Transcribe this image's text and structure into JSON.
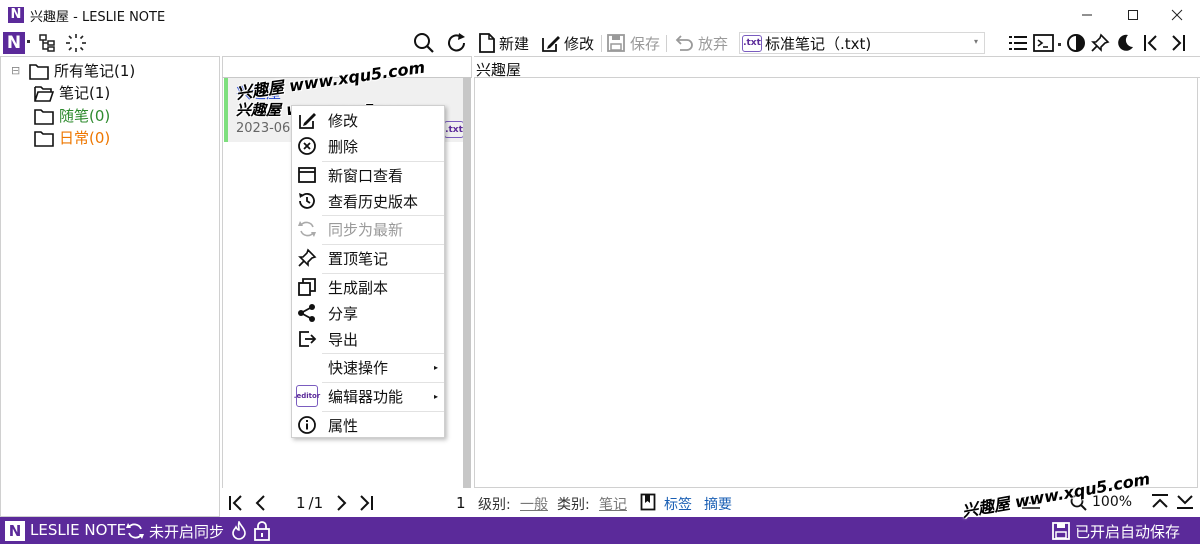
{
  "window": {
    "logo": "N",
    "title": "兴趣屋 - LESLIE NOTE"
  },
  "toolbar": {
    "new_label": "新建",
    "edit_label": "修改",
    "save_label": "保存",
    "discard_label": "放弃",
    "note_type_badge": ".txt",
    "note_type": "标准笔记（.txt)"
  },
  "tree": {
    "items": [
      {
        "label": "所有笔记(1)",
        "color": "#111111"
      },
      {
        "label": "笔记(1)",
        "color": "#111111"
      },
      {
        "label": "随笔(0)",
        "color": "#2e8b2e"
      },
      {
        "label": "日常(0)",
        "color": "#ee7700"
      }
    ]
  },
  "list": {
    "note": {
      "title": "兴趣屋",
      "summary": "兴趣屋 www.xqu5.com",
      "date": "2023-06-0",
      "badge": ".txt"
    },
    "pager": {
      "current": "1",
      "total": "/1",
      "count": "1"
    }
  },
  "editor": {
    "title": "兴趣屋",
    "level_label": "级别:",
    "level_value": "一般",
    "category_label": "类别:",
    "category_value": "笔记",
    "tags_label": "标签",
    "summary_label": "摘要",
    "zoom": "100%"
  },
  "context_menu": {
    "items": [
      {
        "label": "修改",
        "icon": "edit-icon"
      },
      {
        "label": "删除",
        "icon": "delete-icon"
      },
      {
        "label": "新窗口查看",
        "icon": "window-icon"
      },
      {
        "label": "查看历史版本",
        "icon": "history-icon"
      },
      {
        "label": "同步为最新",
        "icon": "sync-icon"
      },
      {
        "label": "置顶笔记",
        "icon": "pin-icon"
      },
      {
        "label": "生成副本",
        "icon": "copy-icon"
      },
      {
        "label": "分享",
        "icon": "share-icon"
      },
      {
        "label": "导出",
        "icon": "export-icon"
      },
      {
        "label": "快速操作",
        "icon": ""
      },
      {
        "label": "编辑器功能",
        "icon": "editor-icon"
      },
      {
        "label": "属性",
        "icon": "info-icon"
      }
    ],
    "editor_badge": ".editor"
  },
  "status": {
    "app_name": "LESLIE NOTE",
    "sync_status": "未开启同步",
    "autosave_status": "已开启自动保存"
  },
  "watermark": {
    "text": "兴趣屋 www.xqu5.com"
  },
  "colors": {
    "accent": "#5b2a9a",
    "link": "#1a5fb4",
    "active_note_bar": "#7ddf7d"
  }
}
